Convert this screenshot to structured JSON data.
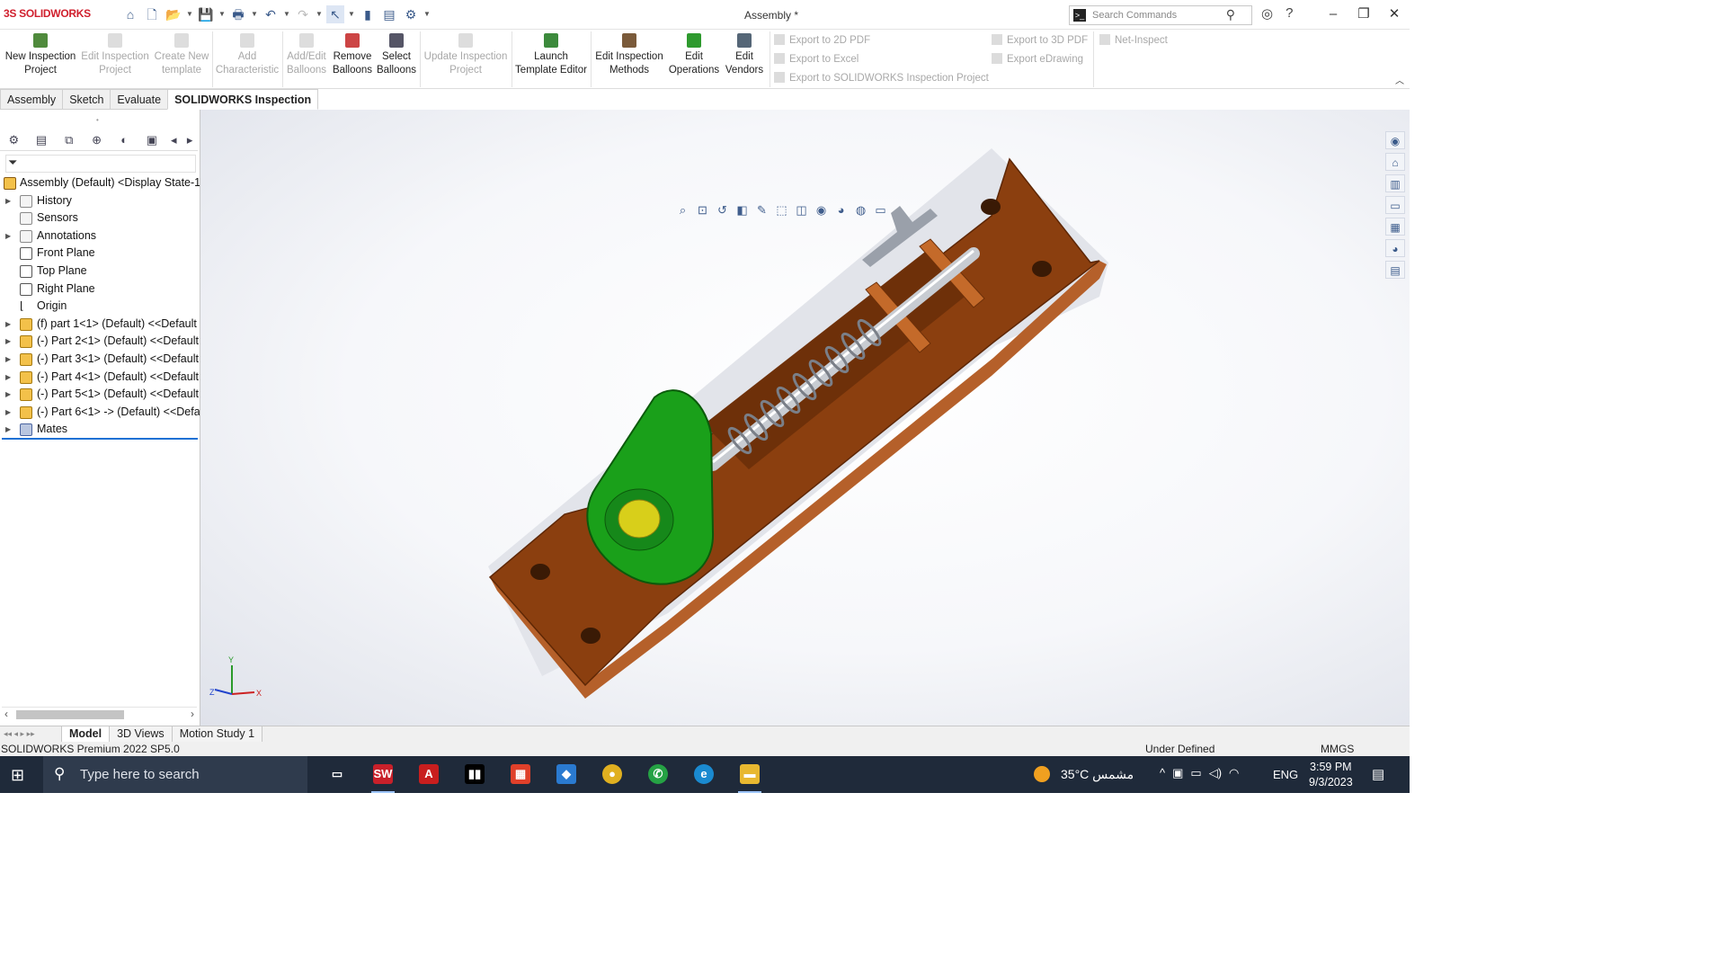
{
  "app": {
    "name": "SOLIDWORKS",
    "doc_title": "Assembly *"
  },
  "search": {
    "placeholder": "Search Commands"
  },
  "ribbon": {
    "buttons": [
      {
        "label": "New Inspection Project",
        "enabled": true
      },
      {
        "label": "Edit Inspection Project",
        "enabled": false
      },
      {
        "label": "Create New template",
        "enabled": false
      },
      {
        "label": "Add Characteristic",
        "enabled": false
      },
      {
        "label": "Add/Edit Balloons",
        "enabled": false
      },
      {
        "label": "Remove Balloons",
        "enabled": true
      },
      {
        "label": "Select Balloons",
        "enabled": true
      },
      {
        "label": "Update Inspection Project",
        "enabled": false
      },
      {
        "label": "Launch Template Editor",
        "enabled": true
      },
      {
        "label": "Edit Inspection Methods",
        "enabled": true
      },
      {
        "label": "Edit Operations",
        "enabled": true
      },
      {
        "label": "Edit Vendors",
        "enabled": true
      }
    ],
    "exports": [
      "Export to 2D PDF",
      "Export to Excel",
      "Export to SOLIDWORKS Inspection Project",
      "Export to 3D PDF",
      "Export eDrawing",
      "Net-Inspect"
    ]
  },
  "tabs": [
    "Assembly",
    "Sketch",
    "Evaluate",
    "SOLIDWORKS Inspection"
  ],
  "tree": {
    "root": "Assembly (Default) <Display State-1",
    "items": [
      "History",
      "Sensors",
      "Annotations",
      "Front Plane",
      "Top Plane",
      "Right Plane",
      "Origin",
      "(f) part 1<1> (Default) <<Default",
      "(-) Part 2<1> (Default) <<Default",
      "(-) Part 3<1> (Default) <<Default",
      "(-) Part 4<1> (Default) <<Default",
      "(-) Part 5<1> (Default) <<Default",
      "(-) Part 6<1> -> (Default) <<Defa",
      "Mates"
    ]
  },
  "bottom_tabs": [
    "Model",
    "3D Views",
    "Motion Study 1"
  ],
  "status": {
    "version": "SOLIDWORKS Premium 2022 SP5.0",
    "state": "Under Defined",
    "units": "MMGS"
  },
  "triad": {
    "x": "X",
    "y": "Y",
    "z": "Z"
  },
  "taskbar": {
    "search_placeholder": "Type here to search",
    "apps": [
      "SolidWorks",
      "Autodesk",
      "Media",
      "Office",
      "Files",
      "Chrome",
      "WhatsApp",
      "Edge",
      "Explorer"
    ],
    "temperature": "35°C",
    "weather_label": "مشمس",
    "language": "ENG",
    "time": "3:59 PM",
    "date": "9/3/2023"
  },
  "colors": {
    "accent": "#1d70d4",
    "base_plate": "#8b3f0f",
    "cam": "#1aa01a",
    "logo": "#d0202e"
  }
}
